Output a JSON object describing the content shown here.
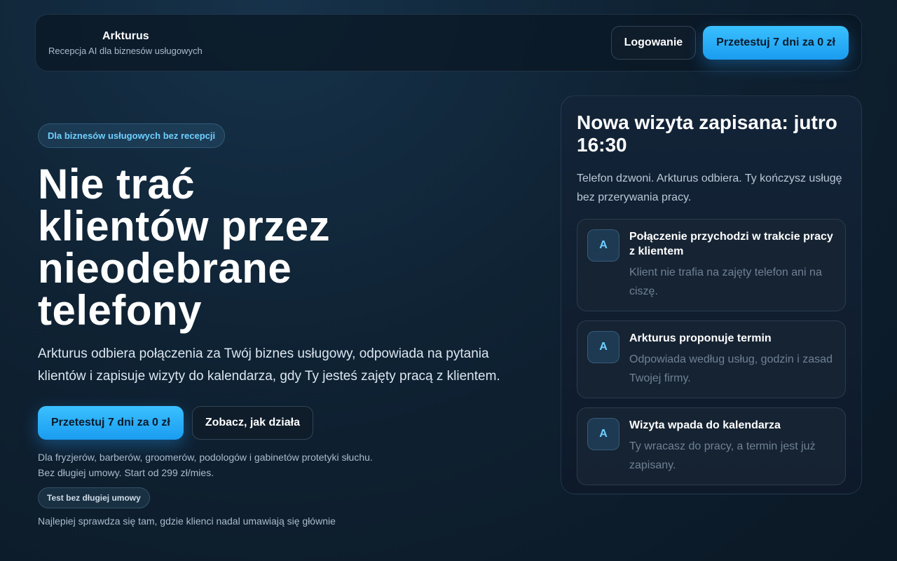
{
  "header": {
    "brand_name": "Arkturus",
    "brand_tagline": "Recepcja AI dla biznesów usługowych",
    "login_label": "Logowanie",
    "trial_label": "Przetestuj 7 dni za 0 zł"
  },
  "hero": {
    "eyebrow": "Dla biznesów usługowych bez recepcji",
    "headline": "Nie trać klientów przez nieodebrane telefony",
    "lead": "Arkturus odbiera połączenia za Twój biznes usługowy, odpowiada na pytania klientów i zapisuje wizyty do kalendarza, gdy Ty jesteś zajęty pracą z klientem.",
    "primary_cta": "Przetestuj 7 dni za 0 zł",
    "secondary_cta": "Zobacz, jak działa",
    "audience": "Dla fryzjerów, barberów, groomerów, podologów i gabinetów protetyki słuchu.",
    "pricing": "Bez długiej umowy. Start od 299 zł/mies.",
    "chip": "Test bez długiej umowy",
    "cutoff_text": "Najlepiej sprawdza się tam, gdzie klienci nadal umawiają się głównie"
  },
  "card": {
    "title": "Nowa wizyta zapisana: jutro 16:30",
    "subtitle": "Telefon dzwoni. Arkturus odbiera. Ty kończysz usługę bez przerywania pracy.",
    "steps": [
      {
        "avatar": "A",
        "title": "Połączenie przychodzi w trakcie pracy z klientem",
        "desc": "Klient nie trafia na zajęty telefon ani na ciszę."
      },
      {
        "avatar": "A",
        "title": "Arkturus proponuje termin",
        "desc": "Odpowiada według usług, godzin i zasad Twojej firmy."
      },
      {
        "avatar": "A",
        "title": "Wizyta wpada do kalendarza",
        "desc": "Ty wracasz do pracy, a termin jest już zapisany."
      }
    ]
  },
  "colors": {
    "accent": "#3ac0ff",
    "background": "#0f2233",
    "eyebrow_text": "#6fd0ff"
  }
}
